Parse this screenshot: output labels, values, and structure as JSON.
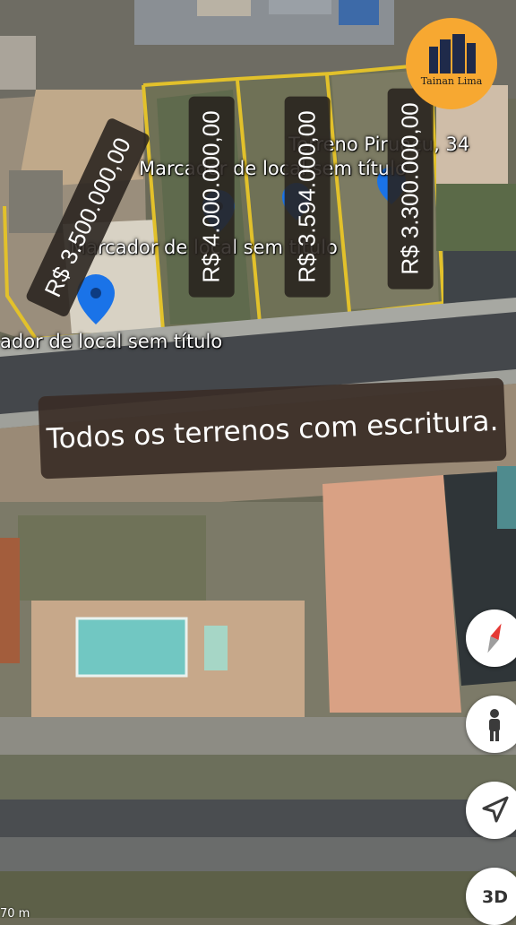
{
  "logo": {
    "text": "Tainan Lima",
    "background": "#f7a831"
  },
  "map": {
    "place_label_top": "Terreno Piruaçu, 34",
    "marker_labels": [
      "Marcador de local sem título",
      "Marcador de local sem título",
      "ador de local sem título"
    ],
    "marker_color": "#1a73e8",
    "scale_text": "70 m"
  },
  "prices": [
    {
      "label": "R$ 3.500.000,00"
    },
    {
      "label": "R$ 4.000.000,00"
    },
    {
      "label": "R$ 3.594.000,00"
    },
    {
      "label": "R$ 3.300.000,00"
    }
  ],
  "banner": {
    "text": "Todos os terrenos com escritura."
  },
  "controls": {
    "compass": "compass-icon",
    "street_view": "pegman-icon",
    "my_location": "navigation-arrow-icon",
    "view_3d": "3D"
  },
  "colors": {
    "lot_border": "#e2c12b"
  }
}
